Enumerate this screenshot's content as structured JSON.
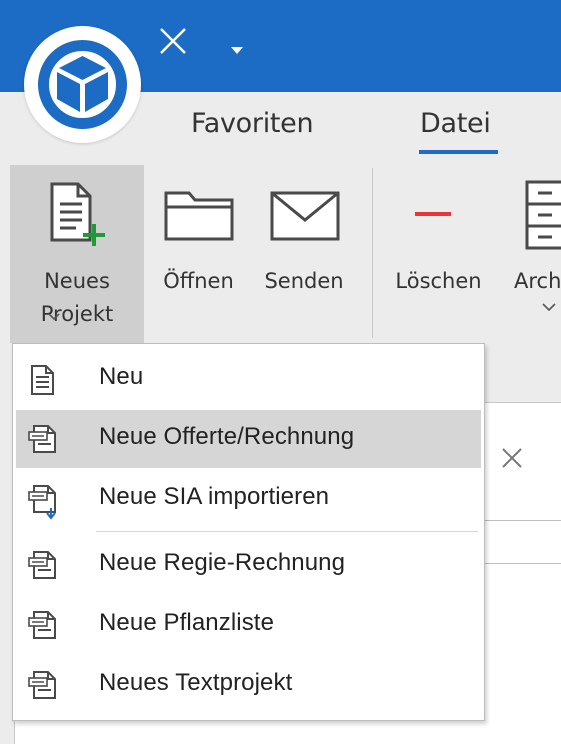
{
  "app": {
    "accent_color": "#1c6bc4",
    "logo_icon": "cube-logo-icon",
    "quick_access": {
      "close_icon": "close-icon",
      "dropdown_icon": "caret-down-icon"
    }
  },
  "ribbon": {
    "tabs": [
      {
        "label": "Favoriten",
        "active": false
      },
      {
        "label": "Datei",
        "active": true
      }
    ],
    "buttons": {
      "neues_projekt": {
        "label_line1": "Neues",
        "label_line2": "Projekt",
        "icon": "new-document-icon",
        "pressed": true
      },
      "oeffnen": {
        "label": "Öffnen",
        "icon": "folder-icon"
      },
      "senden": {
        "label": "Senden",
        "icon": "envelope-icon"
      },
      "loeschen": {
        "label": "Löschen",
        "icon": "delete-icon",
        "color": "#e8343a"
      },
      "archiv": {
        "label": "Arch",
        "icon": "archive-cabinet-icon"
      }
    }
  },
  "dropdown_menu": {
    "items": [
      {
        "label": "Neu",
        "icon": "document-icon",
        "highlighted": false
      },
      {
        "label": "Neue Offerte/Rechnung",
        "icon": "offer-document-icon",
        "highlighted": true
      },
      {
        "label": "Neue SIA importieren",
        "icon": "sia-import-icon",
        "highlighted": false
      },
      {
        "label": "Neue Regie-Rechnung",
        "icon": "regie-document-icon",
        "highlighted": false
      },
      {
        "label": "Neue Pflanzliste",
        "icon": "plant-list-icon",
        "highlighted": false
      },
      {
        "label": "Neues Textprojekt",
        "icon": "text-project-icon",
        "highlighted": false
      }
    ]
  }
}
